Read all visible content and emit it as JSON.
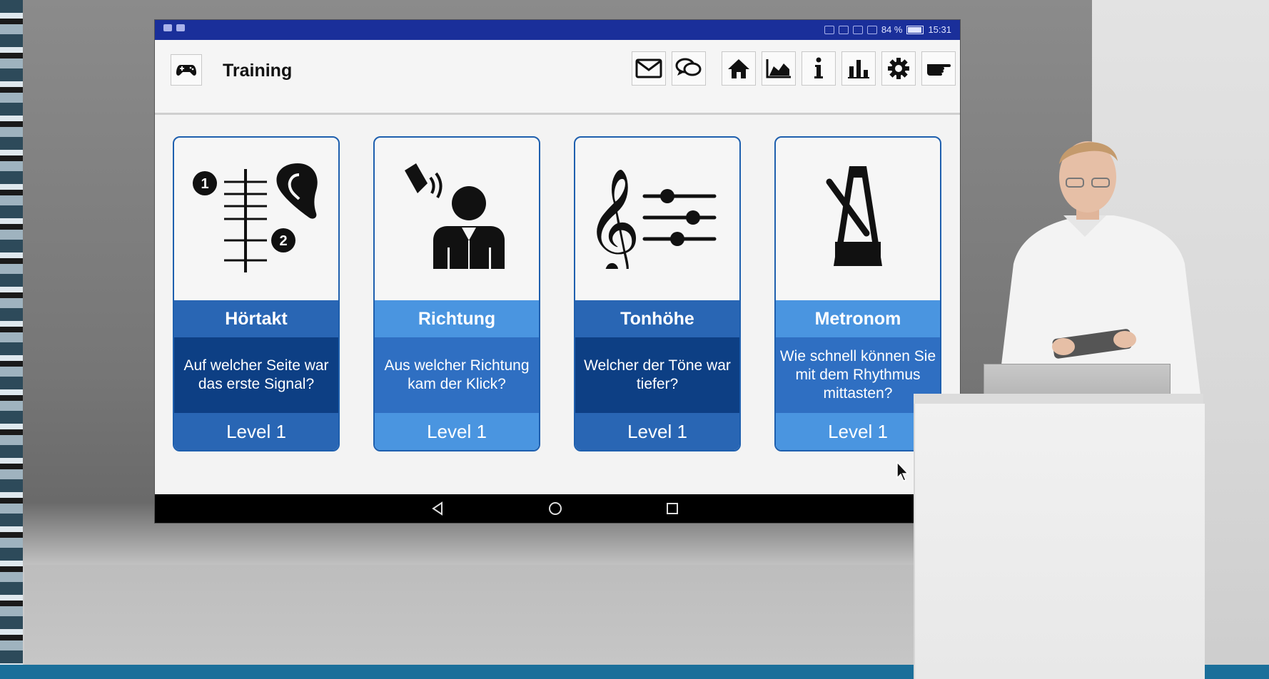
{
  "status_bar": {
    "battery": "84 %",
    "time": "15:31"
  },
  "header": {
    "menu_icon": "gamepad-icon",
    "title": "Training",
    "toolbar": [
      {
        "name": "mail",
        "icon": "mail-icon"
      },
      {
        "name": "chat",
        "icon": "chat-icon"
      },
      {
        "name": "home",
        "icon": "home-icon"
      },
      {
        "name": "progress-chart",
        "icon": "area-chart-icon"
      },
      {
        "name": "info",
        "icon": "info-icon"
      },
      {
        "name": "statistics",
        "icon": "bar-chart-icon"
      },
      {
        "name": "settings",
        "icon": "gear-icon"
      },
      {
        "name": "pointer",
        "icon": "pointing-hand-icon"
      }
    ]
  },
  "cards": [
    {
      "title": "Hörtakt",
      "description": "Auf welcher Seite war das erste Signal?",
      "level": "Level 1",
      "icon": "ear-timeline-icon"
    },
    {
      "title": "Richtung",
      "description": "Aus welcher Richtung kam der Klick?",
      "level": "Level 1",
      "icon": "speaker-person-icon"
    },
    {
      "title": "Tonhöhe",
      "description": "Welcher der Töne war tiefer?",
      "level": "Level 1",
      "icon": "treble-clef-sliders-icon"
    },
    {
      "title": "Metronom",
      "description": "Wie schnell können Sie mit dem Rhythmus mittasten?",
      "level": "Level 1",
      "icon": "metronome-icon"
    }
  ],
  "nav": {
    "back": "back-icon",
    "home": "circle-home-icon",
    "recents": "square-recents-icon"
  },
  "colors": {
    "status_bar": "#1a2f9a",
    "card_dark": "#2966b4",
    "card_dark_desc": "#0d3f84",
    "card_light": "#4a95e0",
    "card_light_desc": "#2f6fc2"
  }
}
